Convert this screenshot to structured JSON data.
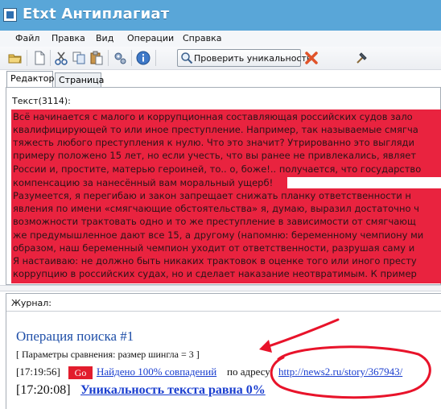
{
  "window": {
    "title": "Etxt Антиплагиат"
  },
  "menu": [
    "Файл",
    "Правка",
    "Вид",
    "Операции",
    "Справка"
  ],
  "toolbar": {
    "icons": [
      "open-folder-icon",
      "new-document-icon",
      "cut-icon",
      "copy-icon",
      "paste-icon",
      "settings-icon",
      "info-icon",
      "magnifier-icon",
      "stop-icon",
      "hammer-icon"
    ],
    "check_label": "Проверить уникальность"
  },
  "tabs": [
    {
      "label": "Редактор",
      "active": true
    },
    {
      "label": "Страница",
      "active": false
    }
  ],
  "editor": {
    "label": "Текст(3114):",
    "highlight_color": "#e9233f",
    "lines": [
      "Всё начинается с малого и коррупционная составляющая российских судов зало",
      "квалифицирующей то или иное преступление. Например, так называемые смягча",
      "тяжесть любого преступления к нулю. Что это значит? Утрированно это выгляди",
      "примеру положено 15 лет, но если учесть, что вы ранее не привлекались, являет",
      "России и, простите, матерью героиней, то.. о, боже!.. получается, что государство",
      "компенсацию за нанесённый вам моральный ущерб!",
      "Разумеется, я перегибаю и закон запрещает снижать планку ответственности н",
      "явления по имени «смягчающие обстоятельства» я, думаю, выразил достаточно ч",
      "возможности трактовать одно и то же преступление в зависимости от смягчающ",
      "же предумышленное дают все 15, а другому (напомню: беременному чемпиону ми",
      "образом, наш беременный чемпион уходит от ответственности, разрушая саму и",
      "Я настаиваю: не должно быть никаких трактовок в оценке того или иного престу",
      "коррупцию в российских судах, но и сделает наказание неотвратимым. К пример"
    ]
  },
  "journal": {
    "label": "Журнал:",
    "operation_title": "Операция поиска #1",
    "params": "[ Параметры сравнения: размер шингла = 3 ]",
    "row1": {
      "time": "[17:19:56]",
      "go_label": "Go",
      "found": "Найдено 100% совпадений",
      "address_label": "по адресу:",
      "url": "http://news2.ru/story/367943/"
    },
    "row2": {
      "time": "[17:20:08]",
      "uniqueness": "Уникальность текста равна 0%"
    }
  }
}
